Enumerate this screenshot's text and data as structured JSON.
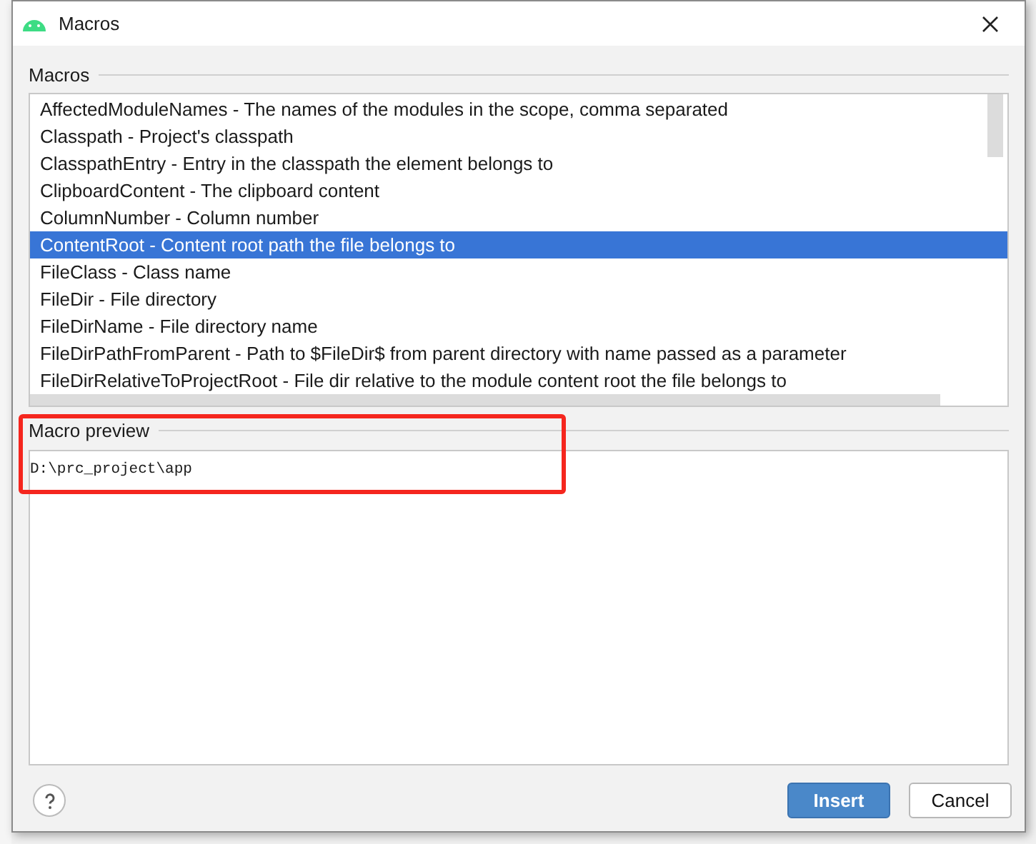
{
  "window": {
    "title": "Macros"
  },
  "macros": {
    "label": "Macros",
    "items": [
      {
        "text": "AffectedModuleNames - The names of the modules in the scope, comma separated",
        "selected": false
      },
      {
        "text": "Classpath - Project's classpath",
        "selected": false
      },
      {
        "text": "ClasspathEntry - Entry in the classpath the element belongs to",
        "selected": false
      },
      {
        "text": "ClipboardContent - The clipboard content",
        "selected": false
      },
      {
        "text": "ColumnNumber - Column number",
        "selected": false
      },
      {
        "text": "ContentRoot - Content root path the file belongs to",
        "selected": true
      },
      {
        "text": "FileClass - Class name",
        "selected": false
      },
      {
        "text": "FileDir - File directory",
        "selected": false
      },
      {
        "text": "FileDirName - File directory name",
        "selected": false
      },
      {
        "text": "FileDirPathFromParent - Path to $FileDir$ from parent directory with name passed as a parameter",
        "selected": false
      },
      {
        "text": "FileDirRelativeToProjectRoot - File dir relative to the module content root the file belongs to",
        "selected": false
      }
    ]
  },
  "preview": {
    "label": "Macro preview",
    "value": "D:\\prc_project\\app"
  },
  "buttons": [
    {
      "label": "Insert",
      "kind": "primary"
    },
    {
      "label": "Cancel",
      "kind": "secondary"
    }
  ]
}
